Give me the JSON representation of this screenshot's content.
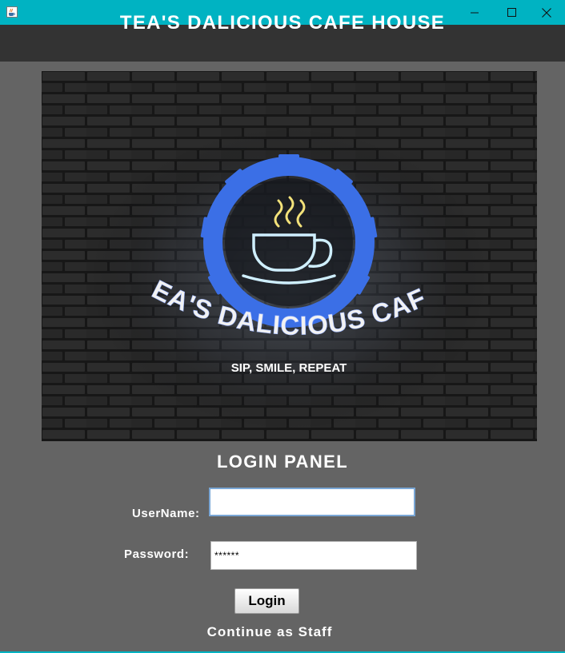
{
  "window": {
    "app_icon": "java-coffee-icon",
    "controls": {
      "minimize": "minimize-icon",
      "maximize": "maximize-icon",
      "close": "close-icon"
    }
  },
  "header": {
    "title": "TEA'S DALICIOUS CAFE HOUSE"
  },
  "banner": {
    "logo_title": "TEA'S DALICIOUS CAFE",
    "logo_tagline": "SIP, SMILE, REPEAT",
    "logo_icon": "coffee-cup-gear-icon"
  },
  "login": {
    "heading": "LOGIN PANEL",
    "username_label": "UserName:",
    "username_value": "",
    "password_label": "Password:",
    "password_value": "******",
    "login_button": "Login",
    "staff_link": "Continue as Staff"
  },
  "colors": {
    "titlebar": "#00b3c2",
    "header_bg": "#333333",
    "panel_bg": "#646464",
    "neon_blue": "#3b6fe6",
    "neon_cup": "#cfefff"
  }
}
